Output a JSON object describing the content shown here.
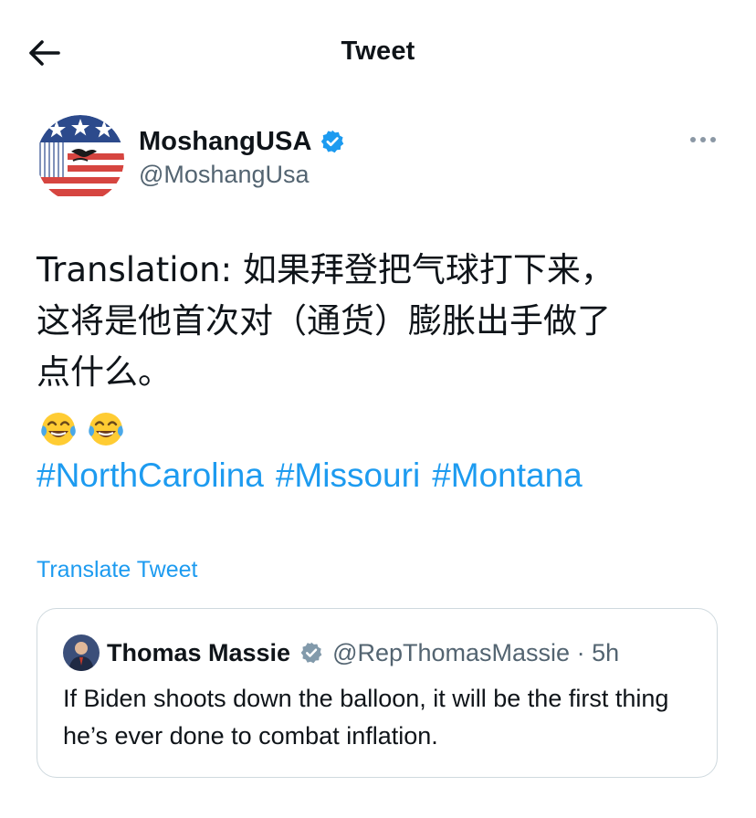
{
  "header": {
    "title": "Tweet",
    "back_icon": "arrow-left-icon"
  },
  "author": {
    "name": "MoshangUSA",
    "handle": "@MoshangUsa",
    "verified": true,
    "avatar_icon": "flag-eagle-avatar"
  },
  "tweet": {
    "lines": [
      "Translation: 如果拜登把气球打下来，",
      "这将是他首次对（通货）膨胀出手做了",
      "点什么。"
    ],
    "emojis": [
      "tears-of-joy-emoji",
      "tears-of-joy-emoji"
    ],
    "hashtags": [
      "#NorthCarolina",
      "#Missouri",
      "#Montana"
    ],
    "translate_label": "Translate Tweet"
  },
  "quote": {
    "name": "Thomas Massie",
    "handle_time": "@RepThomasMassie · 5h",
    "text": "If Biden shoots down the balloon, it will be the first thing he’s ever done to combat inflation."
  },
  "colors": {
    "link": "#1d9bf0",
    "secondary_text": "#536471",
    "border": "#cfd9de"
  }
}
